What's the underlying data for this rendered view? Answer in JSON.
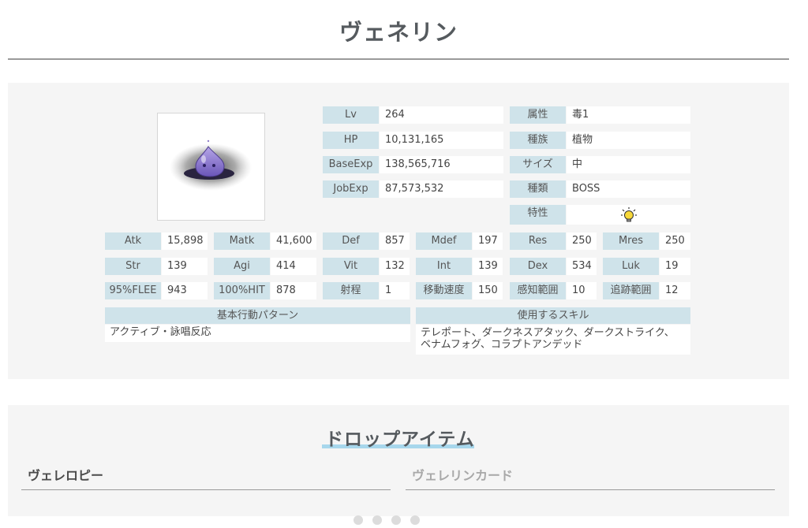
{
  "monster": {
    "name": "ヴェネリン"
  },
  "stats_top": [
    {
      "label": "Lv",
      "value": "264"
    },
    {
      "label": "HP",
      "value": "10,131,165"
    },
    {
      "label": "BaseExp",
      "value": "138,565,716"
    },
    {
      "label": "JobExp",
      "value": "87,573,532"
    }
  ],
  "attrs": [
    {
      "label": "属性",
      "value": "毒1"
    },
    {
      "label": "種族",
      "value": "植物"
    },
    {
      "label": "サイズ",
      "value": "中"
    },
    {
      "label": "種類",
      "value": "BOSS"
    },
    {
      "label": "特性",
      "value": ""
    }
  ],
  "stats_row1": [
    {
      "label": "Atk",
      "value": "15,898"
    },
    {
      "label": "Matk",
      "value": "41,600"
    },
    {
      "label": "Def",
      "value": "857"
    },
    {
      "label": "Mdef",
      "value": "197"
    },
    {
      "label": "Res",
      "value": "250"
    },
    {
      "label": "Mres",
      "value": "250"
    }
  ],
  "stats_row2": [
    {
      "label": "Str",
      "value": "139"
    },
    {
      "label": "Agi",
      "value": "414"
    },
    {
      "label": "Vit",
      "value": "132"
    },
    {
      "label": "Int",
      "value": "139"
    },
    {
      "label": "Dex",
      "value": "534"
    },
    {
      "label": "Luk",
      "value": "19"
    }
  ],
  "stats_row3": [
    {
      "label": "95%FLEE",
      "value": "943"
    },
    {
      "label": "100%HIT",
      "value": "878"
    },
    {
      "label": "射程",
      "value": "1"
    },
    {
      "label": "移動速度",
      "value": "150"
    },
    {
      "label": "感知範囲",
      "value": "10"
    },
    {
      "label": "追跡範囲",
      "value": "12"
    }
  ],
  "behavior": {
    "label": "基本行動パターン",
    "value": "アクティブ・詠唱反応"
  },
  "skills": {
    "label": "使用するスキル",
    "line1": "テレポート、ダークネスアタック、ダークストライク、",
    "line2": "ベナムフォグ、コラプトアンデッド"
  },
  "drop": {
    "title": "ドロップアイテム",
    "items": [
      "ヴェレロピー",
      "ヴェレリンカード"
    ]
  },
  "colors": {
    "label_bg": "#cfe3ea",
    "accent_underline": "#a7d7ec",
    "title": "#555a5e"
  },
  "icons": {
    "trait": "lightbulb-icon"
  }
}
